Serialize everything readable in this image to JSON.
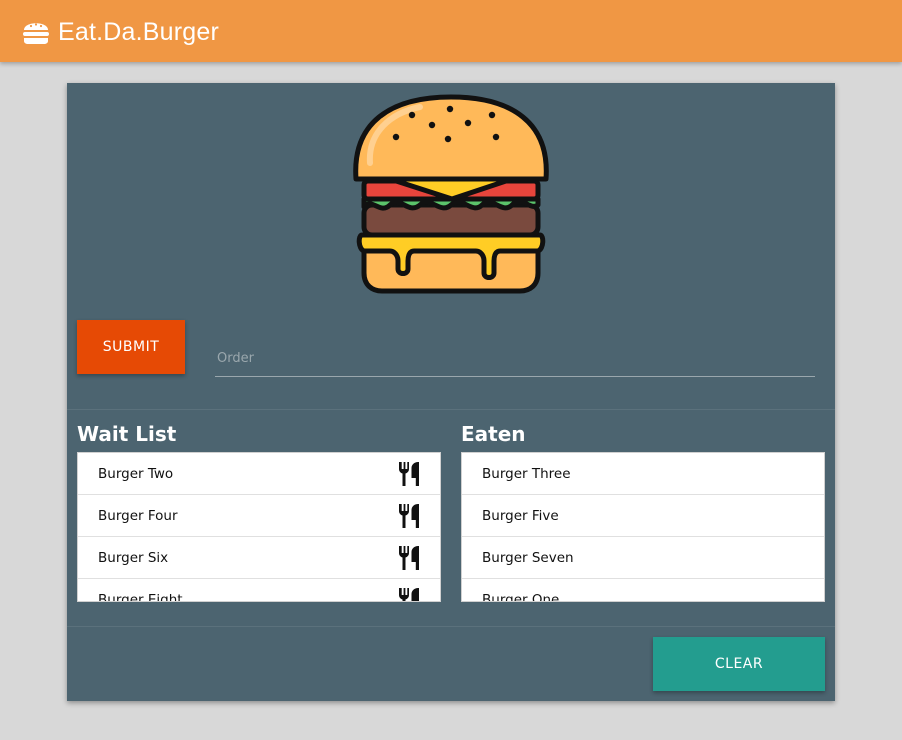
{
  "navbar": {
    "brand": "Eat.Da.Burger",
    "brand_icon": "burger-icon",
    "color": "#f09744"
  },
  "order_form": {
    "submit_label": "SUBMIT",
    "placeholder": "Order",
    "value": ""
  },
  "wait_list": {
    "title": "Wait List",
    "action_icon": "utensils-icon",
    "items": [
      {
        "label": "Burger Two"
      },
      {
        "label": "Burger Four"
      },
      {
        "label": "Burger Six"
      },
      {
        "label": "Burger Eight"
      }
    ]
  },
  "eaten_list": {
    "title": "Eaten",
    "items": [
      {
        "label": "Burger Three"
      },
      {
        "label": "Burger Five"
      },
      {
        "label": "Burger Seven"
      },
      {
        "label": "Burger One"
      }
    ]
  },
  "clear_label": "CLEAR",
  "colors": {
    "card": "#4c6470",
    "submit": "#e64a05",
    "clear": "#239d8f",
    "background": "#d8d8d8"
  }
}
